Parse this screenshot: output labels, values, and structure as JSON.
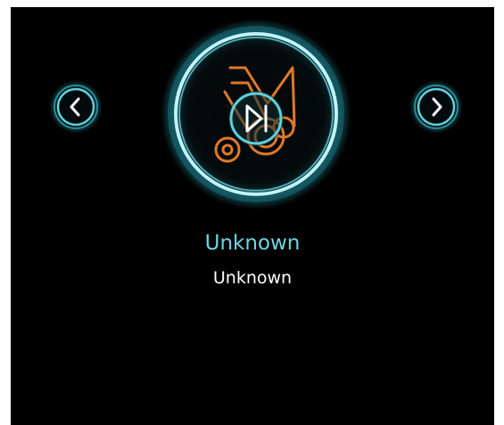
{
  "player": {
    "track_title": "Unknown",
    "artist_name": "Unknown"
  },
  "controls": {
    "prev_icon": "chevron-left-icon",
    "next_icon": "chevron-right-icon",
    "play_pause_icon": "play-pause-icon",
    "artwork_icon": "music-note-icon"
  },
  "colors": {
    "accent": "#6fd6e2",
    "artwork": "#e0792a",
    "background": "#000000",
    "text": "#ffffff"
  }
}
